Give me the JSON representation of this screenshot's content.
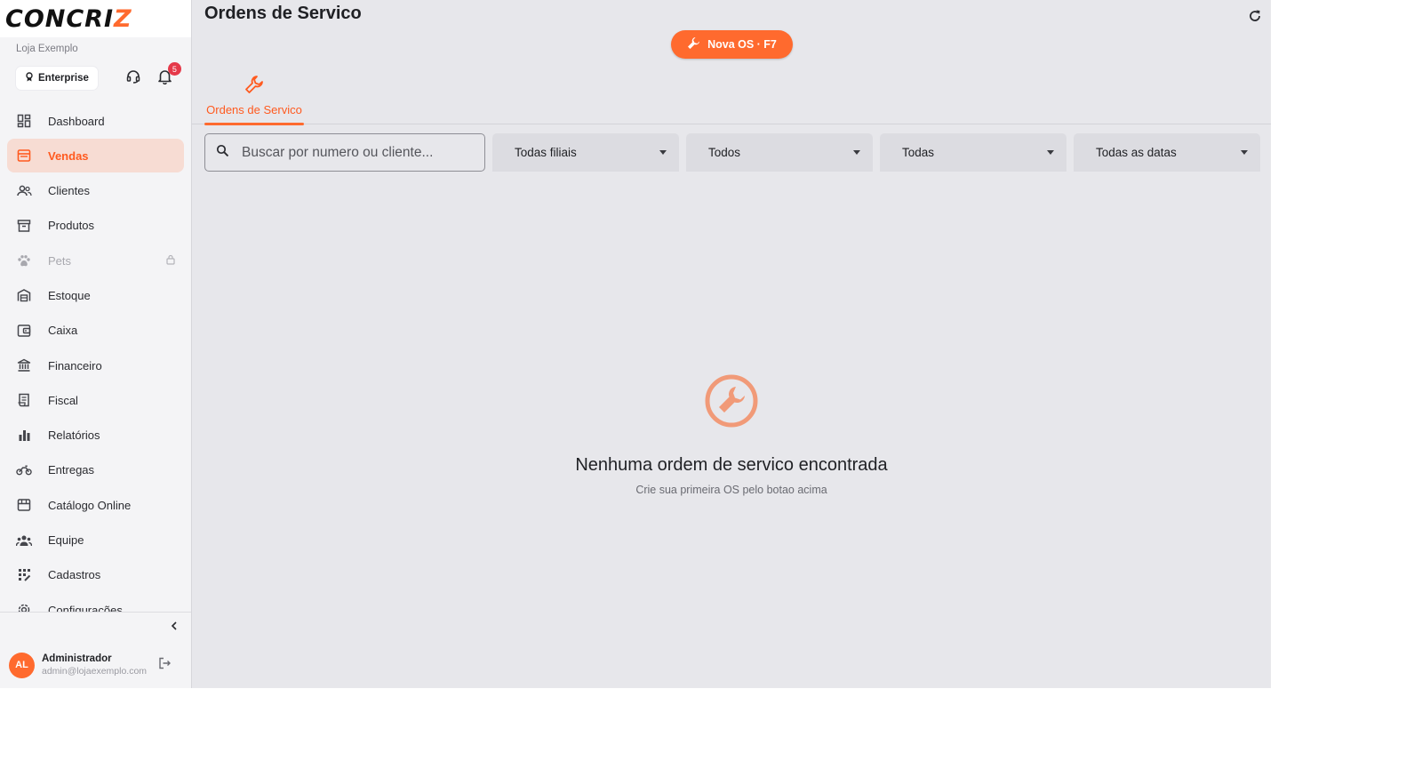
{
  "brand": {
    "logo_main": "CONCRI",
    "logo_accent": "Z",
    "accent_color": "#ff6a2e"
  },
  "sidebar": {
    "store_name": "Loja Exemplo",
    "plan_label": "Enterprise",
    "notifications_count": "5",
    "items": [
      {
        "label": "Dashboard",
        "icon": "dashboard-icon"
      },
      {
        "label": "Vendas",
        "icon": "store-icon",
        "active": true
      },
      {
        "label": "Clientes",
        "icon": "people-icon"
      },
      {
        "label": "Produtos",
        "icon": "archive-icon"
      },
      {
        "label": "Pets",
        "icon": "paw-icon",
        "disabled": true
      },
      {
        "label": "Estoque",
        "icon": "warehouse-icon"
      },
      {
        "label": "Caixa",
        "icon": "wallet-icon"
      },
      {
        "label": "Financeiro",
        "icon": "bank-icon"
      },
      {
        "label": "Fiscal",
        "icon": "receipt-icon"
      },
      {
        "label": "Relatórios",
        "icon": "bar-chart-icon"
      },
      {
        "label": "Entregas",
        "icon": "motorcycle-icon"
      },
      {
        "label": "Catálogo Online",
        "icon": "storefront-icon"
      },
      {
        "label": "Equipe",
        "icon": "team-icon"
      },
      {
        "label": "Cadastros",
        "icon": "grid-icon"
      },
      {
        "label": "Configurações",
        "icon": "gear-icon"
      }
    ],
    "user": {
      "initials": "AL",
      "name": "Administrador",
      "email": "admin@lojaexemplo.com"
    }
  },
  "header": {
    "title": "Ordens de Servico",
    "primary_button": "Nova OS · F7"
  },
  "tabs": [
    {
      "label": "Ordens de Servico",
      "active": true
    }
  ],
  "filters": {
    "search_placeholder": "Buscar por numero ou cliente...",
    "branch": "Todas filiais",
    "status": "Todos",
    "type": "Todas",
    "date": "Todas as datas"
  },
  "empty_state": {
    "title": "Nenhuma ordem de servico encontrada",
    "subtitle": "Crie sua primeira OS pelo botao acima"
  }
}
